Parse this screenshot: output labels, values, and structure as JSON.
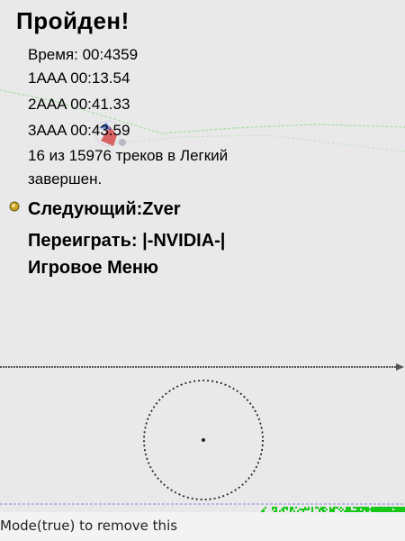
{
  "screen": {
    "title": "Пройден!",
    "time_line": "Время: 00:4359",
    "records": [
      "1AAA  00:13.54",
      "2AAA  00:41.33",
      "3AAA  00:43.59"
    ],
    "progress_line1": "16 из 15976 треков в Легкий",
    "progress_line2": "завершен."
  },
  "menu": {
    "items": [
      {
        "label": "Следующий:Zver"
      },
      {
        "label": "Переиграть: |-NVIDIA-|"
      },
      {
        "label": "Игровое Меню"
      }
    ],
    "selected_icon": "bullet-coin-icon"
  },
  "footer": {
    "console_text": "Mode(true) to remove this"
  },
  "colors": {
    "background": "#e9e9e9",
    "track": "#9fdca0",
    "footer_noise": "#18c818"
  }
}
